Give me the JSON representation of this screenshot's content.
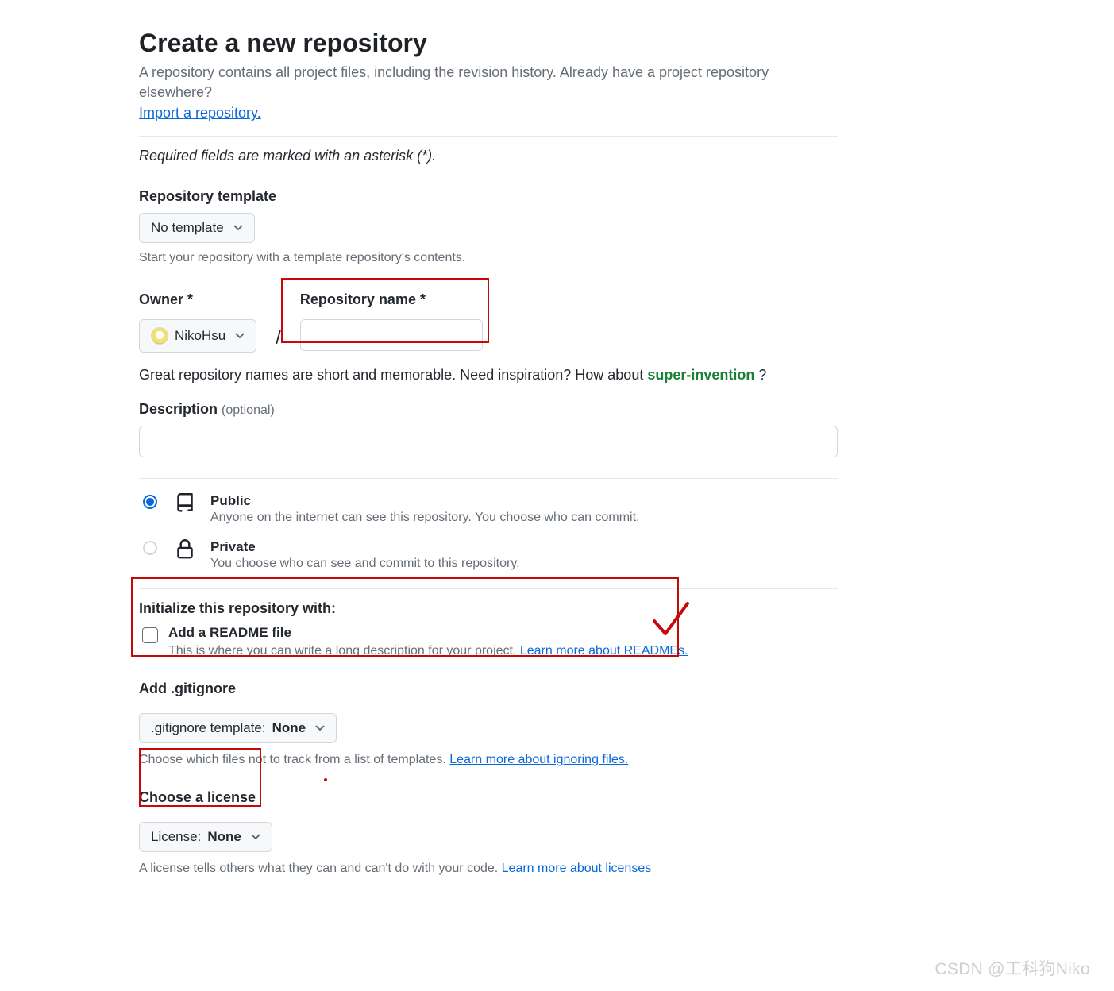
{
  "header": {
    "title": "Create a new repository",
    "subhead": "A repository contains all project files, including the revision history. Already have a project repository elsewhere?",
    "import_link": "Import a repository.",
    "required_note": "Required fields are marked with an asterisk (*)."
  },
  "template": {
    "label": "Repository template",
    "selected": "No template",
    "hint": "Start your repository with a template repository's contents."
  },
  "owner": {
    "label": "Owner *",
    "selected": "NikoHsu"
  },
  "repo_name": {
    "label": "Repository name *",
    "value": ""
  },
  "suggestion": {
    "prefix": "Great repository names are short and memorable. Need inspiration? How about ",
    "name": "super-invention",
    "suffix": " ?"
  },
  "description": {
    "label": "Description",
    "optional": "(optional)",
    "value": ""
  },
  "visibility": {
    "public": {
      "title": "Public",
      "desc": "Anyone on the internet can see this repository. You choose who can commit."
    },
    "private": {
      "title": "Private",
      "desc": "You choose who can see and commit to this repository."
    }
  },
  "initialize": {
    "heading": "Initialize this repository with:",
    "readme_label": "Add a README file",
    "readme_desc": "This is where you can write a long description for your project. ",
    "readme_link": "Learn more about READMEs."
  },
  "gitignore": {
    "label": "Add .gitignore",
    "button_prefix": ".gitignore template: ",
    "button_value": "None",
    "hint": "Choose which files not to track from a list of templates. ",
    "link": "Learn more about ignoring files."
  },
  "license": {
    "label": "Choose a license",
    "button_prefix": "License: ",
    "button_value": "None",
    "hint_partial": "A license tells others what they can and can't do with your code. ",
    "link_partial": "Learn more about licenses"
  },
  "watermark": "CSDN @工科狗Niko"
}
